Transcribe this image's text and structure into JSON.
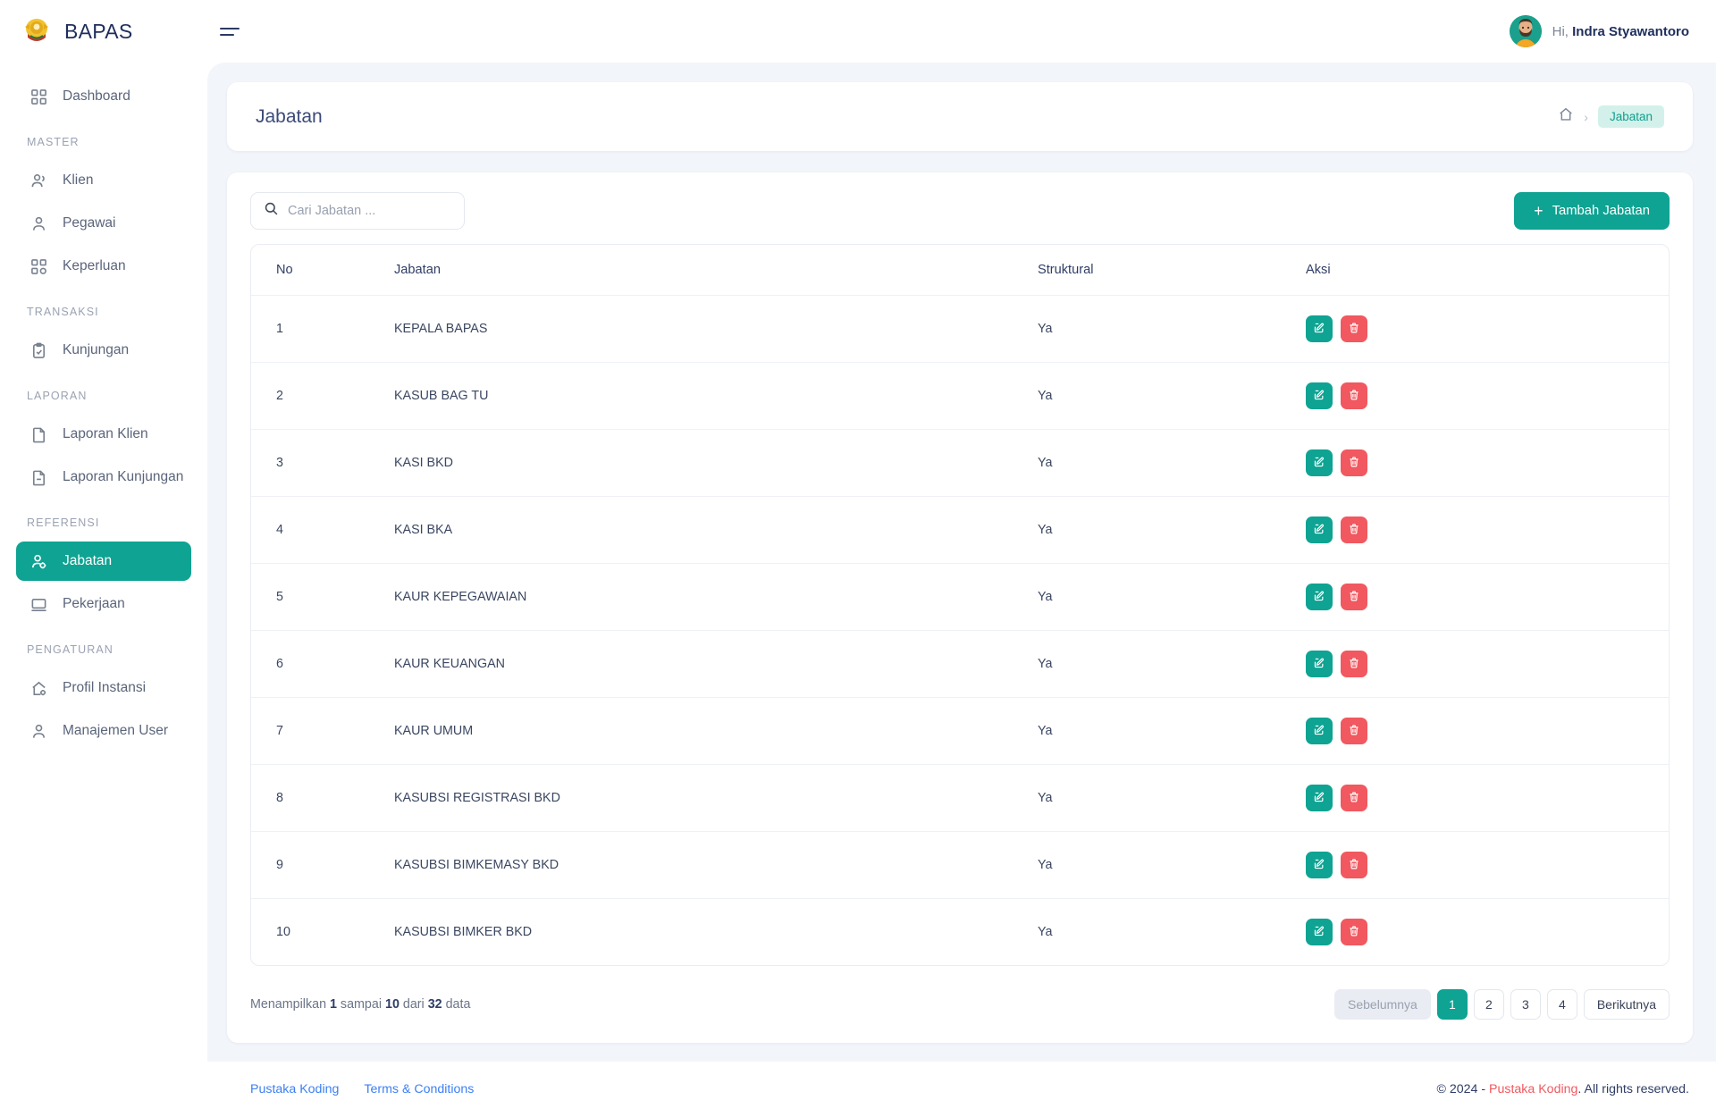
{
  "app": {
    "brand_name": "BAPAS",
    "logo_icon": "garuda-emblem-icon",
    "menu_toggle_icon": "hamburger-icon"
  },
  "header": {
    "greeting_prefix": "Hi,",
    "user_name": "Indra Styawantoro",
    "avatar_icon": "user-avatar-icon"
  },
  "sidebar": {
    "items": [
      {
        "label": "Dashboard",
        "icon": "grid-icon",
        "active": false
      },
      {
        "label": "Klien",
        "icon": "users-icon",
        "active": false
      },
      {
        "label": "Pegawai",
        "icon": "user-icon",
        "active": false
      },
      {
        "label": "Keperluan",
        "icon": "grid-icon",
        "active": false
      },
      {
        "label": "Kunjungan",
        "icon": "clipboard-check-icon",
        "active": false
      },
      {
        "label": "Laporan Klien",
        "icon": "document-icon",
        "active": false
      },
      {
        "label": "Laporan Kunjungan",
        "icon": "document-icon",
        "active": false
      },
      {
        "label": "Jabatan",
        "icon": "user-cog-icon",
        "active": true
      },
      {
        "label": "Pekerjaan",
        "icon": "monitor-icon",
        "active": false
      },
      {
        "label": "Profil Instansi",
        "icon": "home-cog-icon",
        "active": false
      },
      {
        "label": "Manajemen User",
        "icon": "user-icon",
        "active": false
      }
    ],
    "sections": {
      "master": "MASTER",
      "transaksi": "TRANSAKSI",
      "laporan": "LAPORAN",
      "referensi": "REFERENSI",
      "pengaturan": "PENGATURAN"
    }
  },
  "page": {
    "title": "Jabatan",
    "breadcrumb": {
      "home_icon": "home-icon",
      "separator": "›",
      "current": "Jabatan"
    }
  },
  "toolbar": {
    "search_placeholder": "Cari Jabatan ...",
    "search_value": "",
    "search_icon": "search-icon",
    "add_label": "Tambah Jabatan",
    "add_icon": "plus-icon"
  },
  "table": {
    "columns": [
      "No",
      "Jabatan",
      "Struktural",
      "Aksi"
    ],
    "rows": [
      {
        "no": "1",
        "jabatan": "KEPALA BAPAS",
        "struktural": "Ya"
      },
      {
        "no": "2",
        "jabatan": "KASUB BAG TU",
        "struktural": "Ya"
      },
      {
        "no": "3",
        "jabatan": "KASI BKD",
        "struktural": "Ya"
      },
      {
        "no": "4",
        "jabatan": "KASI BKA",
        "struktural": "Ya"
      },
      {
        "no": "5",
        "jabatan": "KAUR KEPEGAWAIAN",
        "struktural": "Ya"
      },
      {
        "no": "6",
        "jabatan": "KAUR KEUANGAN",
        "struktural": "Ya"
      },
      {
        "no": "7",
        "jabatan": "KAUR UMUM",
        "struktural": "Ya"
      },
      {
        "no": "8",
        "jabatan": "KASUBSI REGISTRASI BKD",
        "struktural": "Ya"
      },
      {
        "no": "9",
        "jabatan": "KASUBSI BIMKEMASY BKD",
        "struktural": "Ya"
      },
      {
        "no": "10",
        "jabatan": "KASUBSI BIMKER BKD",
        "struktural": "Ya"
      }
    ],
    "action_icons": {
      "edit": "pencil-square-icon",
      "delete": "trash-icon"
    }
  },
  "pagination": {
    "showing_text": "Menampilkan 1 sampai 10 dari 32 data",
    "showing_parts": {
      "p1": "Menampilkan ",
      "n1": "1",
      "p2": " sampai ",
      "n2": "10",
      "p3": " dari ",
      "n3": "32",
      "p4": " data"
    },
    "prev_label": "Sebelumnya",
    "next_label": "Berikutnya",
    "pages": [
      "1",
      "2",
      "3",
      "4"
    ],
    "current_page": "1"
  },
  "footer": {
    "links": [
      "Pustaka Koding",
      "Terms & Conditions"
    ],
    "copyright_pre": "© 2024 - ",
    "copyright_brand": "Pustaka Koding",
    "copyright_post": ". All rights reserved."
  },
  "colors": {
    "accent_teal": "#0ea392",
    "danger_red": "#f1585f",
    "link_blue": "#3b7ff5",
    "badge_bg": "#d3f1ea",
    "content_bg": "#f2f5fa",
    "text_navy": "#2f3d66"
  }
}
